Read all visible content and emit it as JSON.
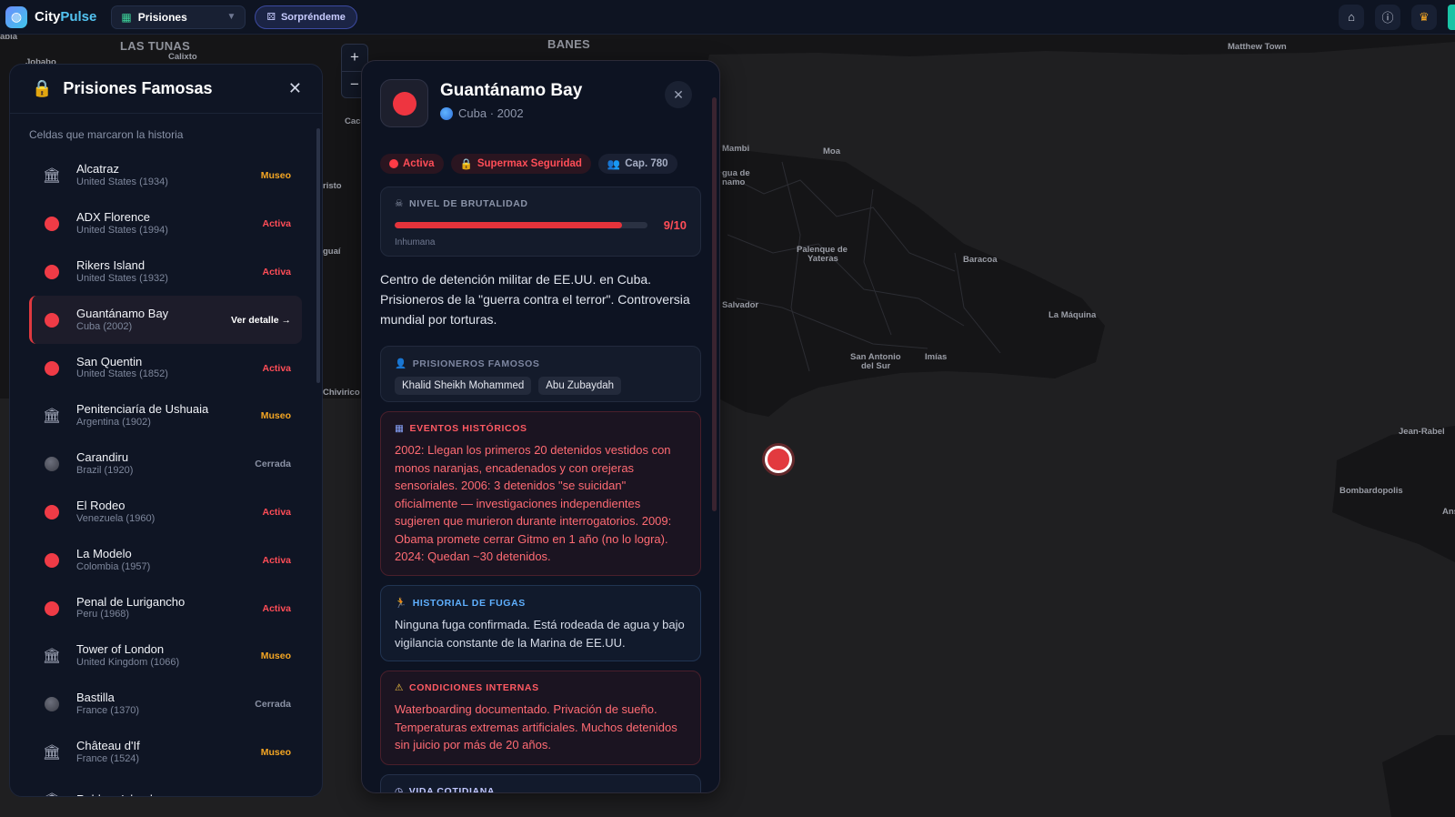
{
  "app": {
    "name_part1": "City",
    "name_part2": "Pulse",
    "category": "Prisiones",
    "surprise_label": "Sorpréndeme"
  },
  "map": {
    "labels": [
      "LAS TUNAS",
      "Calixto",
      "BANES",
      "Matthew Town",
      "Moa",
      "Mambi",
      "gua de",
      "namo",
      "Palenque de",
      "Yateras",
      "Baracoa",
      "La Máquina",
      "Salvador",
      "San Antonio",
      "del Sur",
      "Imías",
      "risto",
      "guaí",
      "Chivirico",
      "Cac",
      "Jean-Rabel",
      "Bombardopolis",
      "Ans",
      "abia",
      "Jobabo"
    ]
  },
  "list_panel": {
    "title": "Prisiones Famosas",
    "subtitle": "Celdas que marcaron la historia",
    "items": [
      {
        "name": "Alcatraz",
        "meta": "United States (1934)",
        "status": "Museo",
        "kind": "museo"
      },
      {
        "name": "ADX Florence",
        "meta": "United States (1994)",
        "status": "Activa",
        "kind": "activa"
      },
      {
        "name": "Rikers Island",
        "meta": "United States (1932)",
        "status": "Activa",
        "kind": "activa"
      },
      {
        "name": "Guantánamo Bay",
        "meta": "Cuba (2002)",
        "status": "Ver detalle →",
        "kind": "selected"
      },
      {
        "name": "San Quentin",
        "meta": "United States (1852)",
        "status": "Activa",
        "kind": "activa"
      },
      {
        "name": "Penitenciaría de Ushuaia",
        "meta": "Argentina (1902)",
        "status": "Museo",
        "kind": "museo"
      },
      {
        "name": "Carandiru",
        "meta": "Brazil (1920)",
        "status": "Cerrada",
        "kind": "cerrada"
      },
      {
        "name": "El Rodeo",
        "meta": "Venezuela (1960)",
        "status": "Activa",
        "kind": "activa"
      },
      {
        "name": "La Modelo",
        "meta": "Colombia (1957)",
        "status": "Activa",
        "kind": "activa"
      },
      {
        "name": "Penal de Lurigancho",
        "meta": "Peru (1968)",
        "status": "Activa",
        "kind": "activa"
      },
      {
        "name": "Tower of London",
        "meta": "United Kingdom (1066)",
        "status": "Museo",
        "kind": "museo"
      },
      {
        "name": "Bastilla",
        "meta": "France (1370)",
        "status": "Cerrada",
        "kind": "cerrada"
      },
      {
        "name": "Château d'If",
        "meta": "France (1524)",
        "status": "Museo",
        "kind": "museo"
      },
      {
        "name": "Robben Island",
        "meta": "",
        "status": "Museo",
        "kind": "museo"
      }
    ]
  },
  "detail": {
    "title": "Guantánamo Bay",
    "subtitle": "Cuba · 2002",
    "badges": {
      "status": "Activa",
      "security": "Supermax Seguridad",
      "capacity": "Cap. 780"
    },
    "brutality": {
      "label": "NIVEL DE BRUTALIDAD",
      "value_text": "9/10",
      "fraction": 0.9,
      "caption": "Inhumana"
    },
    "description": "Centro de detención militar de EE.UU. en Cuba. Prisioneros de la \"guerra contra el terror\". Controversia mundial por torturas.",
    "famous": {
      "label": "PRISIONEROS FAMOSOS",
      "names": [
        "Khalid Sheikh Mohammed",
        "Abu Zubaydah"
      ]
    },
    "events": {
      "label": "EVENTOS HISTÓRICOS",
      "text": "2002: Llegan los primeros 20 detenidos vestidos con monos naranjas, encadenados y con orejeras sensoriales. 2006: 3 detenidos \"se suicidan\" oficialmente — investigaciones independientes sugieren que murieron durante interrogatorios. 2009: Obama promete cerrar Gitmo en 1 año (no lo logra). 2024: Quedan ~30 detenidos."
    },
    "escapes": {
      "label": "HISTORIAL DE FUGAS",
      "text": "Ninguna fuga confirmada. Está rodeada de agua y bajo vigilancia constante de la Marina de EE.UU."
    },
    "conditions": {
      "label": "CONDICIONES INTERNAS",
      "text": "Waterboarding documentado. Privación de sueño. Temperaturas extremas artificiales. Muchos detenidos sin juicio por más de 20 años."
    },
    "daily": {
      "label": "VIDA COTIDIANA"
    }
  },
  "colors": {
    "accent_red": "#e5333b",
    "museo": "#f5a623",
    "activa": "#ff4d57",
    "cerrada": "#8b92a5",
    "escape_blue": "#5fb0ff"
  }
}
